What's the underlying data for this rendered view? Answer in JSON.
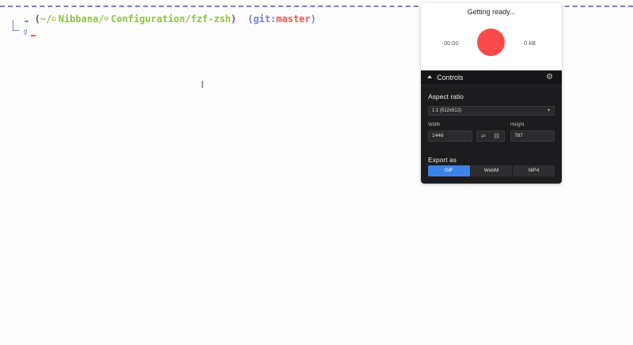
{
  "terminal": {
    "prompt": {
      "paren_open": "(",
      "path_prefix": "~/",
      "path_mid": "Nibbana/",
      "path_end": "Configuration/fzf-zsh",
      "paren_close": ")",
      "git_open": "(git:",
      "git_branch": "master",
      "git_close": ")"
    },
    "colors": {
      "accent": "#6f7fdc",
      "path": "#8bc34a",
      "branch": "#e05a4f"
    }
  },
  "recorder": {
    "status": "Getting ready...",
    "elapsed": "00:00",
    "size": "0 kB",
    "record_color": "#fa4b4b"
  },
  "controls": {
    "title": "Controls",
    "aspect_ratio_label": "Aspect ratio",
    "aspect_ratio_value": "1:1 (512x512)",
    "width_label": "Width",
    "width_value": "1446",
    "height_label": "Height",
    "height_value": "787",
    "export_label": "Export as",
    "formats": [
      {
        "label": "GIF",
        "active": true
      },
      {
        "label": "WebM",
        "active": false
      },
      {
        "label": "MP4",
        "active": false
      }
    ]
  }
}
